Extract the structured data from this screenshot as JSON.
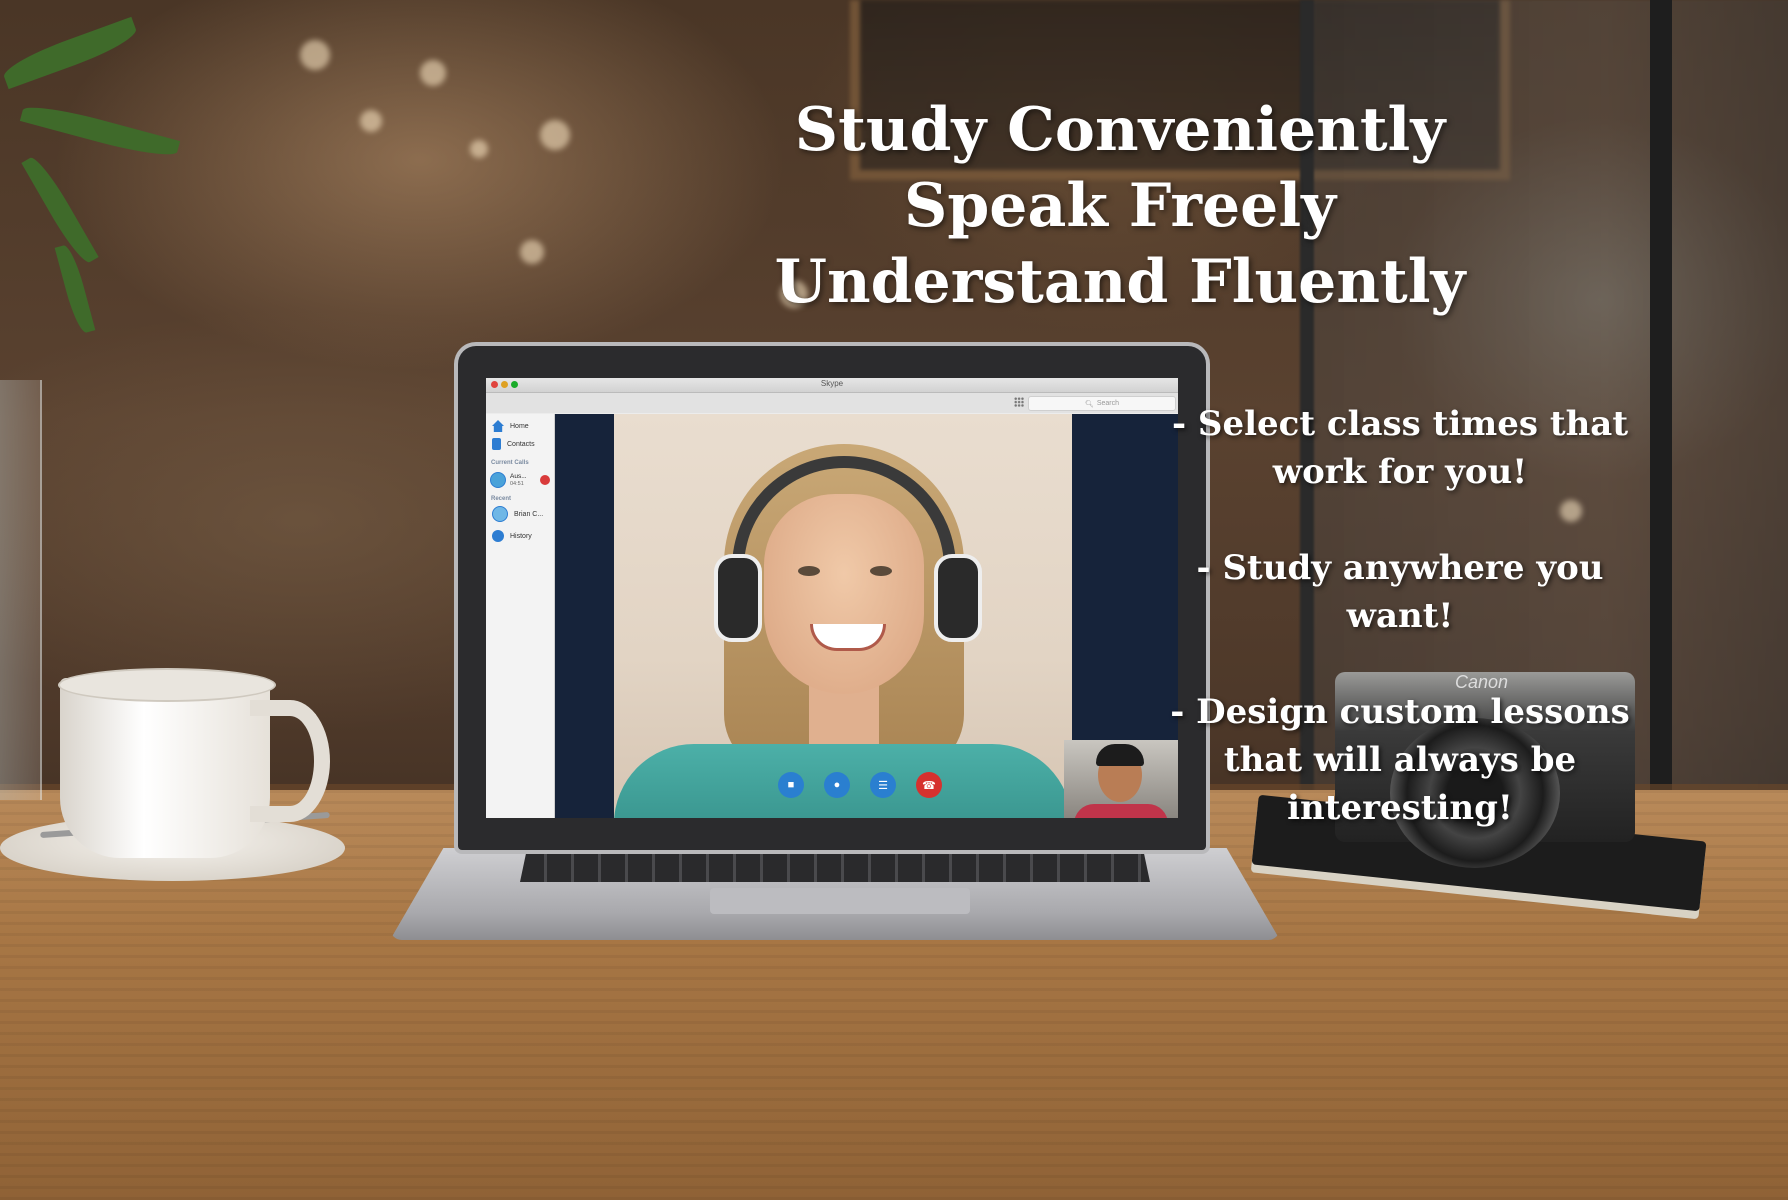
{
  "headline": {
    "line1": "Study Conveniently",
    "line2": "Speak Freely",
    "line3": "Understand Fluently"
  },
  "bullets": [
    {
      "line1": "- Select class times that",
      "line2": "work for you!"
    },
    {
      "line1": "- Study anywhere you",
      "line2": "want!"
    },
    {
      "line1": "- Design custom lessons",
      "line2": "that will always be",
      "line3": "interesting!"
    }
  ],
  "app": {
    "title": "Skype",
    "search_placeholder": "Search",
    "nav": {
      "home": "Home",
      "contacts": "Contacts",
      "current_calls_label": "Current Calls",
      "current_call_name": "Aus...",
      "current_call_time": "04:51",
      "recent_label": "Recent",
      "recent_contact": "Brian C...",
      "history": "History"
    },
    "controls": {
      "video_icon": "video-icon",
      "mic_icon": "mic-icon",
      "menu_icon": "menu-icon",
      "end_icon": "end-call-icon"
    },
    "colors": {
      "accent": "#2a7fd0",
      "end_call": "#d6312f"
    }
  },
  "camera_brand": "Canon"
}
